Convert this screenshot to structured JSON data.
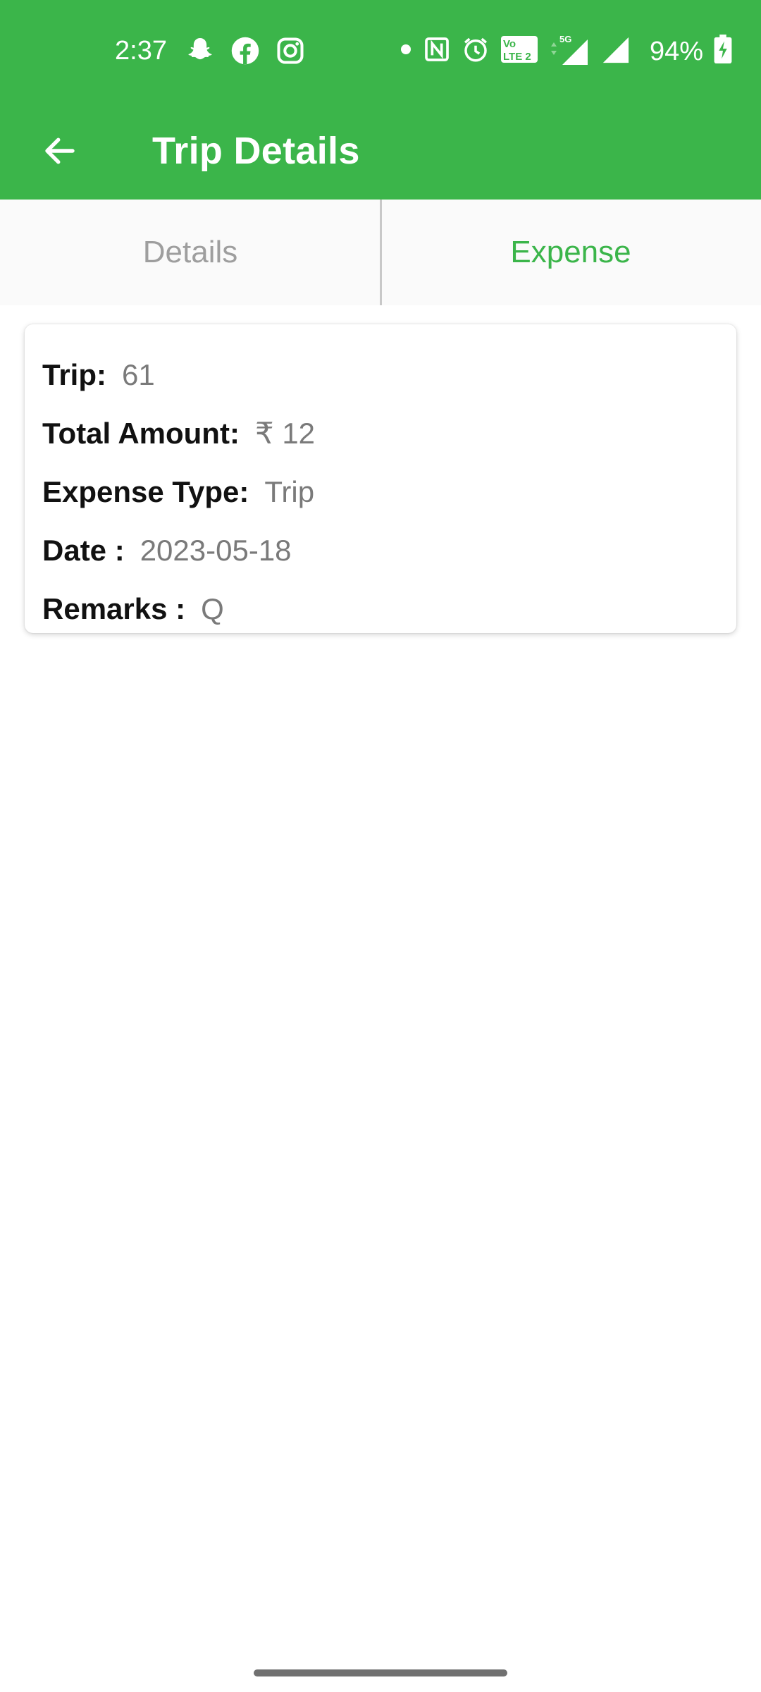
{
  "status_bar": {
    "time": "2:37",
    "battery_percent": "94%",
    "left_icons": [
      "snapchat-icon",
      "facebook-icon",
      "instagram-icon"
    ],
    "right_icons": [
      "dot-icon",
      "nfc-icon",
      "alarm-icon",
      "volte-icon",
      "5g-signal-icon",
      "signal-icon",
      "battery-charging-icon"
    ],
    "volte_text": "Vo LTE 2",
    "network_text": "5G"
  },
  "app_bar": {
    "title": "Trip Details",
    "back_icon": "arrow-left-icon",
    "background": "#3bb54a"
  },
  "tabs": [
    {
      "label": "Details",
      "selected": false
    },
    {
      "label": "Expense",
      "selected": true
    }
  ],
  "expense_card": {
    "trip_label": "Trip:",
    "trip_value": "61",
    "amount_label": "Total Amount:",
    "amount_value": "₹ 12",
    "type_label": "Expense Type:",
    "type_value": "Trip",
    "date_label": "Date :",
    "date_value": "2023-05-18",
    "remarks_label": "Remarks :",
    "remarks_value": "Q"
  },
  "colors": {
    "accent": "#3bb54a",
    "tab_inactive": "#9e9e9e",
    "value_text": "#7a7a7a"
  }
}
